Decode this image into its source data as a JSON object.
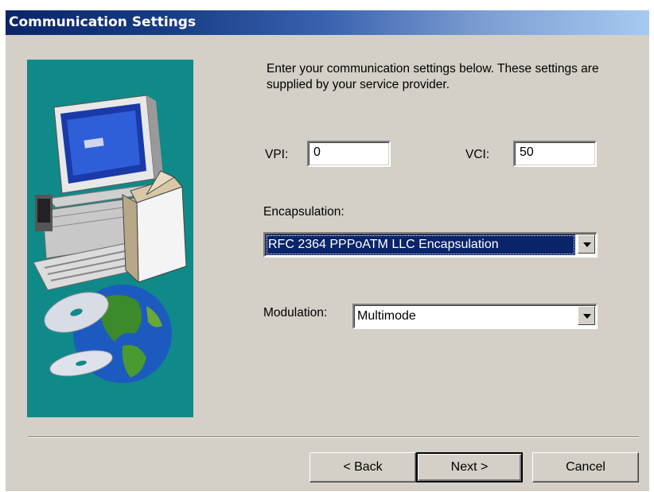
{
  "window": {
    "title": "Communication Settings"
  },
  "intro_text": "Enter your communication settings below.  These settings are supplied by your service provider.",
  "vpi": {
    "label": "VPI:",
    "value": "0"
  },
  "vci": {
    "label": "VCI:",
    "value": "50"
  },
  "encapsulation": {
    "label": "Encapsulation:",
    "selected": "RFC 2364 PPPoATM LLC Encapsulation"
  },
  "modulation": {
    "label": "Modulation:",
    "selected": "Multimode"
  },
  "buttons": {
    "back": "< Back",
    "next": "Next >",
    "cancel": "Cancel"
  },
  "icons": {
    "illustration": "computer-globe-cd-illustration",
    "dropdown": "dropdown-arrow-icon"
  },
  "colors": {
    "panel_teal": "#0f8a88",
    "selection": "#0a246a",
    "dialog_bg": "#d4d0c8"
  }
}
